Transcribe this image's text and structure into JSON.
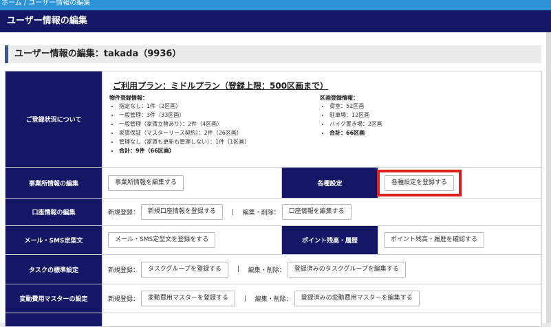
{
  "breadcrumb": "ホーム / ユーザー情報の編集",
  "header": {
    "title": "ユーザー情報の編集"
  },
  "page": {
    "title": "ユーザー情報の編集：takada（9936）"
  },
  "registration": {
    "label": "ご登録状況について",
    "plan": "ご利用プラン：ミドルプラン（登録上限：500区画まで）",
    "property": {
      "title": "物件登録情報：",
      "items": [
        "指定なし：1件（2区画）",
        "一般管理：3件（33区画）",
        "一般管理（家賃立替あり）：2件（4区画）",
        "家賃保証（マスターリース契約）：2件（26区画）",
        "管理なし（家賃も更新も管理しない）：1件（1区画）"
      ],
      "total": "合計：9件（66区画）"
    },
    "section": {
      "title": "区画登録情報：",
      "items": [
        "貸室：52区画",
        "駐車場：12区画",
        "バイク置き場：2区画"
      ],
      "total": "合計：66区画"
    }
  },
  "rows": {
    "office": {
      "label": "事業所情報の編集",
      "button": "事業所情報を編集する"
    },
    "settings": {
      "label": "各種設定",
      "button": "各種設定を登録する"
    },
    "account": {
      "label": "口座情報の編集",
      "new_label": "新規登録：",
      "new_button": "新規口座情報を登録する",
      "separator": "|",
      "edit_label": "編集・削除：",
      "edit_button": "口座情報を編集する"
    },
    "mail": {
      "label": "メール・SMS定型文",
      "button": "メール・SMS定型文を登録をする"
    },
    "points": {
      "label": "ポイント残高・履歴",
      "button": "ポイント残高・履歴を確認する"
    },
    "task": {
      "label": "タスクの標準設定",
      "new_label": "新規登録：",
      "new_button": "タスクグループを登録する",
      "separator": "|",
      "edit_label": "編集・削除：",
      "edit_button": "登録済みのタスクグループを編集する"
    },
    "cost": {
      "label": "変動費用マスターの設定",
      "new_label": "新規登録：",
      "new_button": "変動費用マスターを登録する",
      "separator": "|",
      "edit_label": "編集・削除：",
      "edit_button": "登録済みの変動費用マスターを編集する"
    }
  },
  "colors": {
    "navy": "#141766",
    "top_blue": "#2b93d6",
    "highlight_red": "#e01e1e"
  }
}
